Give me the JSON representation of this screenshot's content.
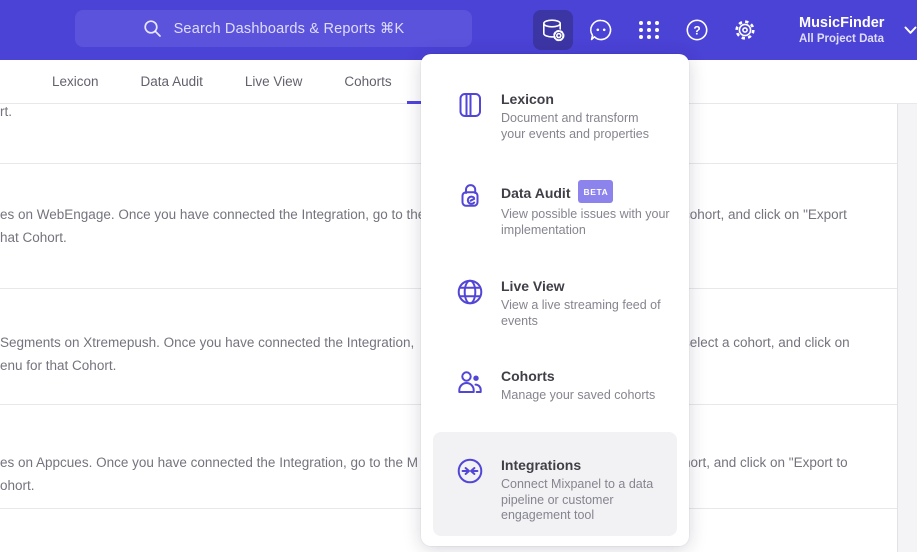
{
  "topbar": {
    "search_placeholder": "Search Dashboards & Reports ⌘K",
    "project_name": "MusicFinder",
    "project_subtitle": "All Project Data",
    "colors": {
      "bar": "#4b42d6",
      "search_pill": "#5b53dc",
      "active_button": "#3c35a4"
    }
  },
  "nav": {
    "tabs": [
      {
        "label": "Lexicon"
      },
      {
        "label": "Data Audit"
      },
      {
        "label": "Live View"
      },
      {
        "label": "Cohorts"
      }
    ],
    "active_indicator_color": "#4f44e0"
  },
  "menu": {
    "accent_color": "#5246d6",
    "badge_color": "#8d83ec",
    "items": [
      {
        "label": "Lexicon",
        "icon": "book-icon",
        "description": "Document and transform\nyour events and properties"
      },
      {
        "label": "Data Audit",
        "icon": "audit-lock-icon",
        "badge": "BETA",
        "description": "View possible issues with your\nimplementation"
      },
      {
        "label": "Live View",
        "icon": "globe-icon",
        "description": "View a live streaming feed of\nevents"
      },
      {
        "label": "Cohorts",
        "icon": "people-icon",
        "description": "Manage your saved cohorts"
      },
      {
        "label": "Integrations",
        "icon": "sync-arrows-icon",
        "highlighted": true,
        "description": "Connect Mixpanel to a data\npipeline or customer\nengagement tool"
      }
    ]
  },
  "content": {
    "rows": [
      {
        "line1_left": "rt.",
        "line1_right": "",
        "line2_left": ""
      },
      {
        "line1_left": "es on WebEngage. Once you have connected the Integration, go to the",
        "line1_right": "cohort, and click on \"Export",
        "line2_left": "hat Cohort."
      },
      {
        "line1_left": "Segments on Xtremepush. Once you have connected the Integration,",
        "line1_right": "select a cohort, and click on",
        "line2_left": "enu for that Cohort."
      },
      {
        "line1_left": "es on Appcues. Once you have connected the Integration, go to the M",
        "line1_right": "hort, and click on \"Export to",
        "line2_left": "ohort."
      }
    ]
  }
}
